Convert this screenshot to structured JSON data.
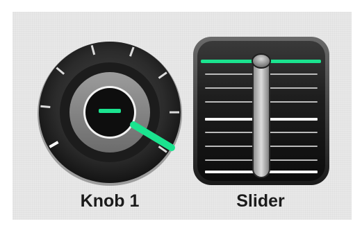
{
  "controls": {
    "knob": {
      "label": "Knob 1",
      "value": 1.0,
      "icon": "knob-icon"
    },
    "slider": {
      "label": "Slider",
      "value": 1.0,
      "icon": "slider-icon"
    }
  },
  "colors": {
    "accent": "#1be38f",
    "panel_background": "#e8e8e8",
    "label_text": "#1b1b1b"
  }
}
